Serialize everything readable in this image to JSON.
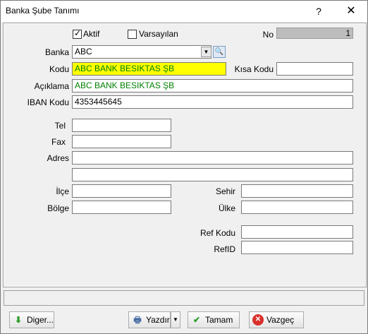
{
  "window": {
    "title": "Banka Şube Tanımı",
    "help_label": "?",
    "close_label": "✕"
  },
  "form": {
    "aktif_label": "Aktif",
    "aktif_checked": true,
    "varsayilan_label": "Varsayılan",
    "varsayilan_checked": false,
    "no_label": "No",
    "no_value": "1",
    "banka_label": "Banka",
    "banka_value": "ABC",
    "kodu_label": "Kodu",
    "kodu_value": "ABC BANK BESIKTAS ŞB",
    "kisa_kodu_label": "Kısa Kodu",
    "kisa_kodu_value": "",
    "aciklama_label": "Açıklama",
    "aciklama_value": "ABC BANK BESIKTAS ŞB",
    "iban_label": "IBAN Kodu",
    "iban_value": "4353445645",
    "tel_label": "Tel",
    "tel_value": "",
    "fax_label": "Fax",
    "fax_value": "",
    "adres_label": "Adres",
    "adres1_value": "",
    "adres2_value": "",
    "ilce_label": "İlçe",
    "ilce_value": "",
    "sehir_label": "Sehir",
    "sehir_value": "",
    "bolge_label": "Bölge",
    "bolge_value": "",
    "ulke_label": "Ülke",
    "ulke_value": "",
    "ref_kodu_label": "Ref Kodu",
    "ref_kodu_value": "",
    "refid_label": "RefID",
    "refid_value": ""
  },
  "buttons": {
    "diger": "Diger...",
    "yazdir": "Yazdır",
    "tamam": "Tamam",
    "vazgec": "Vazgeç"
  },
  "colors": {
    "green_text": "#008000",
    "highlight": "#ffff00"
  }
}
